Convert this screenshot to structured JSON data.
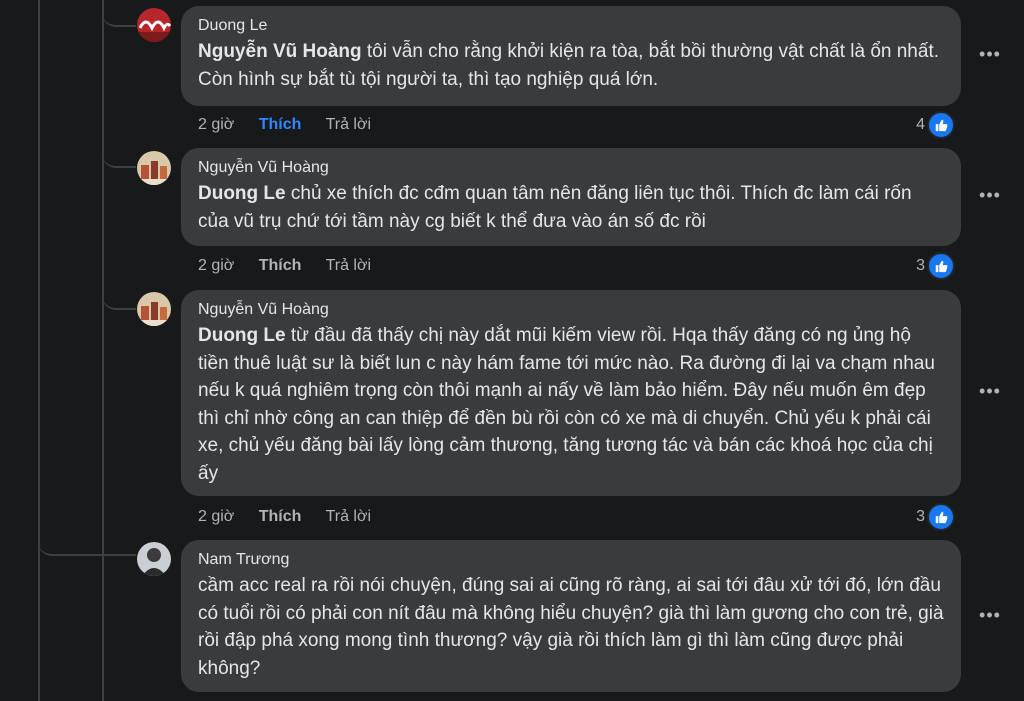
{
  "comments": [
    {
      "author": "Duong Le",
      "mention": "Nguyễn Vũ Hoàng",
      "text": " tôi vẫn cho rằng khởi kiện ra tòa, bắt bồi thường vật chất là ổn nhất. Còn hình sự bắt tù tội người ta, thì tạo nghiệp quá lớn.",
      "time": "2 giờ",
      "like_label": "Thích",
      "reply_label": "Trả lời",
      "reaction_count": "4"
    },
    {
      "author": "Nguyễn Vũ Hoàng",
      "mention": "Duong Le",
      "text": " chủ xe thích đc cđm quan tâm nên đăng liên tục thôi. Thích đc làm cái rốn của vũ trụ chứ tới tầm này cg biết k thể đưa vào án số đc rồi",
      "time": "2 giờ",
      "like_label": "Thích",
      "reply_label": "Trả lời",
      "reaction_count": "3"
    },
    {
      "author": "Nguyễn Vũ Hoàng",
      "mention": "Duong Le",
      "text": " từ đầu đã thấy chị này dắt mũi kiếm view rồi. Hqa thấy đăng có ng ủng hộ tiền thuê luật sư là biết lun c này hám fame tới mức nào. Ra đường đi lại va chạm nhau nếu k quá nghiêm trọng còn thôi mạnh ai nấy về làm bảo hiểm. Đây nếu muốn êm đẹp thì chỉ nhờ công an can thiệp để đền bù rồi còn có xe mà di chuyển. Chủ yếu k phải cái xe, chủ yếu đăng bài lấy lòng cảm thương, tăng tương tác và bán các khoá học của chị ấy",
      "time": "2 giờ",
      "like_label": "Thích",
      "reply_label": "Trả lời",
      "reaction_count": "3"
    },
    {
      "author": "Nam Trương",
      "text": "cầm acc real ra rồi nói chuyện, đúng sai ai cũng rõ ràng, ai sai tới đâu xử tới đó, lớn đầu có tuổi rồi có phải con nít đâu mà không hiểu chuyện? già thì làm gương cho con trẻ, già rồi đập phá xong mong tình thương? vậy già rồi thích làm gì thì làm cũng được phải không?"
    }
  ],
  "more_icon": "more-horizontal-icon",
  "like_icon": "thumbs-up-icon",
  "colors": {
    "bubble": "#3a3b3c",
    "accent": "#2d88ff",
    "like_badge": "#1877f2"
  }
}
